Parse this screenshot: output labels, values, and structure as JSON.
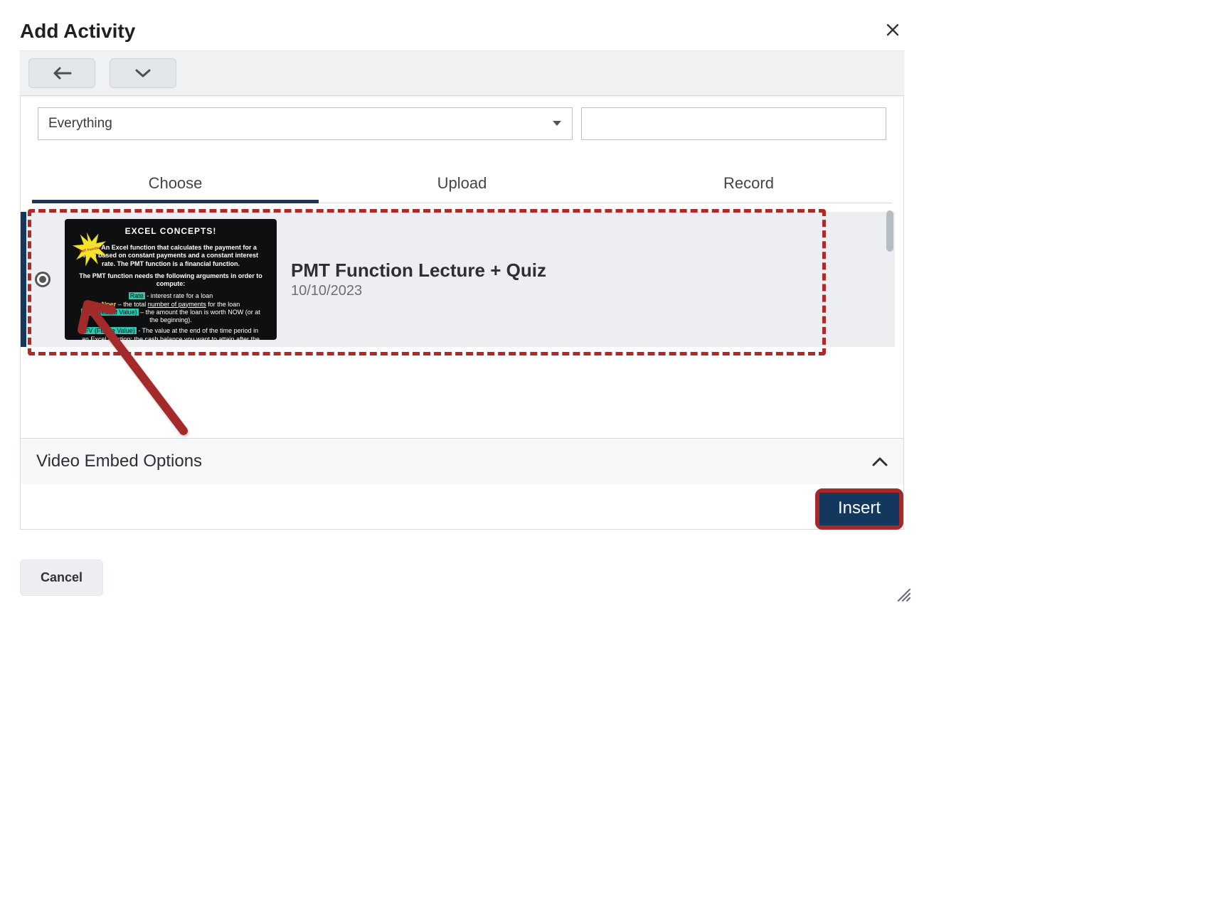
{
  "header": {
    "title": "Add Activity"
  },
  "filter": {
    "selected": "Everything"
  },
  "tabs": {
    "items": [
      "Choose",
      "Upload",
      "Record"
    ],
    "active_index": 0
  },
  "media": {
    "thumbnail": {
      "heading": "EXCEL CONCEPTS!",
      "star_label": "PMT Function",
      "line1": "PMT: An Excel function that calculates the payment for a loan based on constant payments and a constant interest rate. The PMT function is a financial function.",
      "line2": "The PMT function needs the following arguments in order to compute:",
      "arg_rate": "Rate - interest rate for a loan",
      "arg_nper": "Nper – the total number of payments for the loan",
      "arg_pv": "PV (Present Value) – the amount the loan is worth NOW (or at the beginning).",
      "arg_fv": "FV (Future Value) - The value at the end of the time period in an Excel function; the cash balance you want to attain after the last payment is made—usually zero for loans."
    },
    "title": "PMT Function Lecture + Quiz",
    "date": "10/10/2023"
  },
  "embed": {
    "label": "Video Embed Options"
  },
  "actions": {
    "insert": "Insert",
    "cancel": "Cancel"
  }
}
